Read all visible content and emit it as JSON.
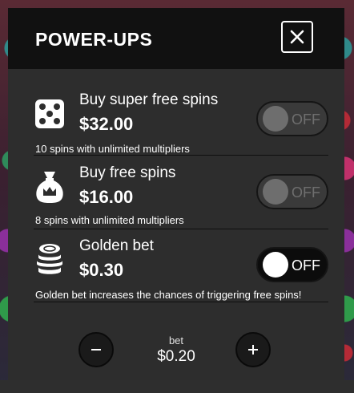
{
  "panel": {
    "title": "POWER-UPS"
  },
  "powerups": [
    {
      "icon": "dice-icon",
      "title": "Buy super free spins",
      "price": "$32.00",
      "description": "10 spins with unlimited multipliers",
      "toggle_label": "OFF",
      "toggle_enabled": false
    },
    {
      "icon": "money-bag-icon",
      "title": "Buy free spins",
      "price": "$16.00",
      "description": "8 spins with unlimited multipliers",
      "toggle_label": "OFF",
      "toggle_enabled": false
    },
    {
      "icon": "coin-stack-icon",
      "title": "Golden bet",
      "price": "$0.30",
      "description": "Golden bet increases the chances of triggering free spins!",
      "toggle_label": "OFF",
      "toggle_enabled": true
    }
  ],
  "bet": {
    "label": "bet",
    "value": "$0.20"
  },
  "colors": {
    "panel_bg": "#2d2d2d",
    "header_bg": "#111111",
    "text": "#ffffff",
    "toggle_disabled": "#6e6e6e"
  }
}
